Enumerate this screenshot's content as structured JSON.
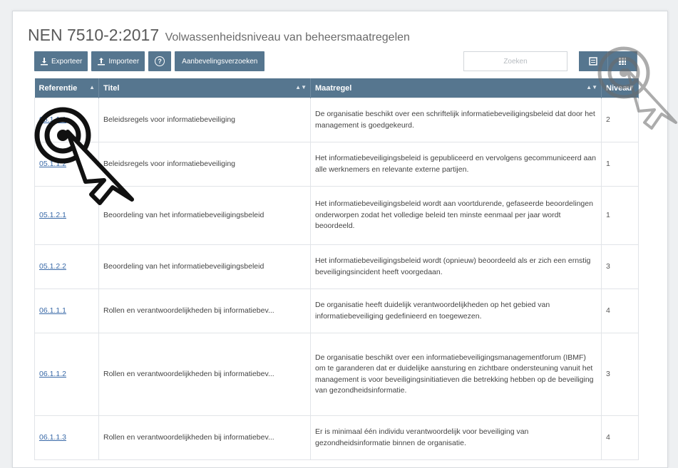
{
  "page": {
    "title": "NEN 7510-2:2017",
    "subtitle": "Volwassenheidsniveau van beheersmaatregelen"
  },
  "toolbar": {
    "export_label": "Exporteer",
    "import_label": "Importeer",
    "help_label": "?",
    "recommendations_label": "Aanbevelingsverzoeken"
  },
  "search": {
    "placeholder": "Zoeken",
    "value": ""
  },
  "table": {
    "columns": [
      "Referentie",
      "Titel",
      "Maatregel",
      "Niveau"
    ],
    "rows": [
      {
        "ref": "05.1.1.1",
        "title": "Beleidsregels voor informatiebeveiliging",
        "measure": "De organisatie beschikt over een schriftelijk informatiebeveiligingsbeleid dat door het management is goedgekeurd.",
        "level": "2"
      },
      {
        "ref": "05.1.1.2",
        "title": "Beleidsregels voor informatiebeveiliging",
        "measure": "Het informatiebeveiligingsbeleid is gepubliceerd en vervolgens gecommuniceerd aan alle werknemers en relevante externe partijen.",
        "level": "1"
      },
      {
        "ref": "05.1.2.1",
        "title": "Beoordeling van het informatiebeveiligingsbeleid",
        "measure": "Het informatiebeveiligingsbeleid wordt aan voortdurende, gefaseerde beoordelingen onderworpen zodat het volledige beleid ten minste eenmaal per jaar wordt beoordeeld.",
        "level": "1"
      },
      {
        "ref": "05.1.2.2",
        "title": "Beoordeling van het informatiebeveiligingsbeleid",
        "measure": "Het informatiebeveiligingsbeleid wordt (opnieuw) beoordeeld als er zich een ernstig beveiligingsincident heeft voorgedaan.",
        "level": "3"
      },
      {
        "ref": "06.1.1.1",
        "title": "Rollen en verantwoordelijkheden bij informatiebev...",
        "measure": "De organisatie heeft duidelijk verantwoordelijkheden op het gebied van informatiebeveiliging gedefinieerd en toegewezen.",
        "level": "4"
      },
      {
        "ref": "06.1.1.2",
        "title": "Rollen en verantwoordelijkheden bij informatiebev...",
        "measure": "De organisatie beschikt over een informatiebeveiligingsmanagementforum (IBMF) om te garanderen dat er duidelijke aansturing en zichtbare ondersteuning vanuit het management is voor beveiligingsinitiatieven die betrekking hebben op de beveiliging van gezondheidsinformatie.",
        "level": "3"
      },
      {
        "ref": "06.1.1.3",
        "title": "Rollen en verantwoordelijkheden bij informatiebev...",
        "measure": "Er is minimaal één individu verantwoordelijk voor beveiliging van gezondheidsinformatie binnen de organisatie.",
        "level": "4"
      }
    ]
  },
  "colors": {
    "header": "#56768f",
    "link": "#3a6aa8"
  }
}
